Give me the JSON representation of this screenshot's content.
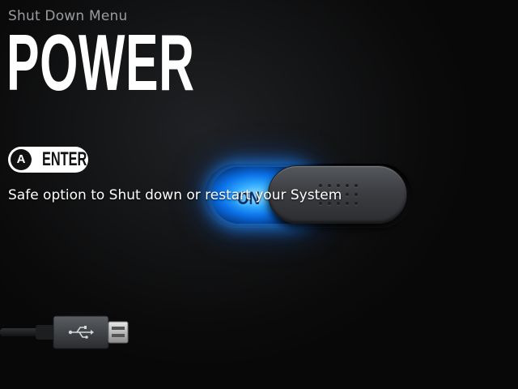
{
  "header": {
    "subtitle": "Shut Down Menu",
    "title": "POWER"
  },
  "action_hint": {
    "button": "A",
    "label": "ENTER"
  },
  "toggle": {
    "state_label": "ON",
    "state": "on",
    "accent_color": "#2fa9ff"
  },
  "description": "Safe option to Shut down or restart your System",
  "illustration": {
    "icon": "usb-cable-icon"
  }
}
